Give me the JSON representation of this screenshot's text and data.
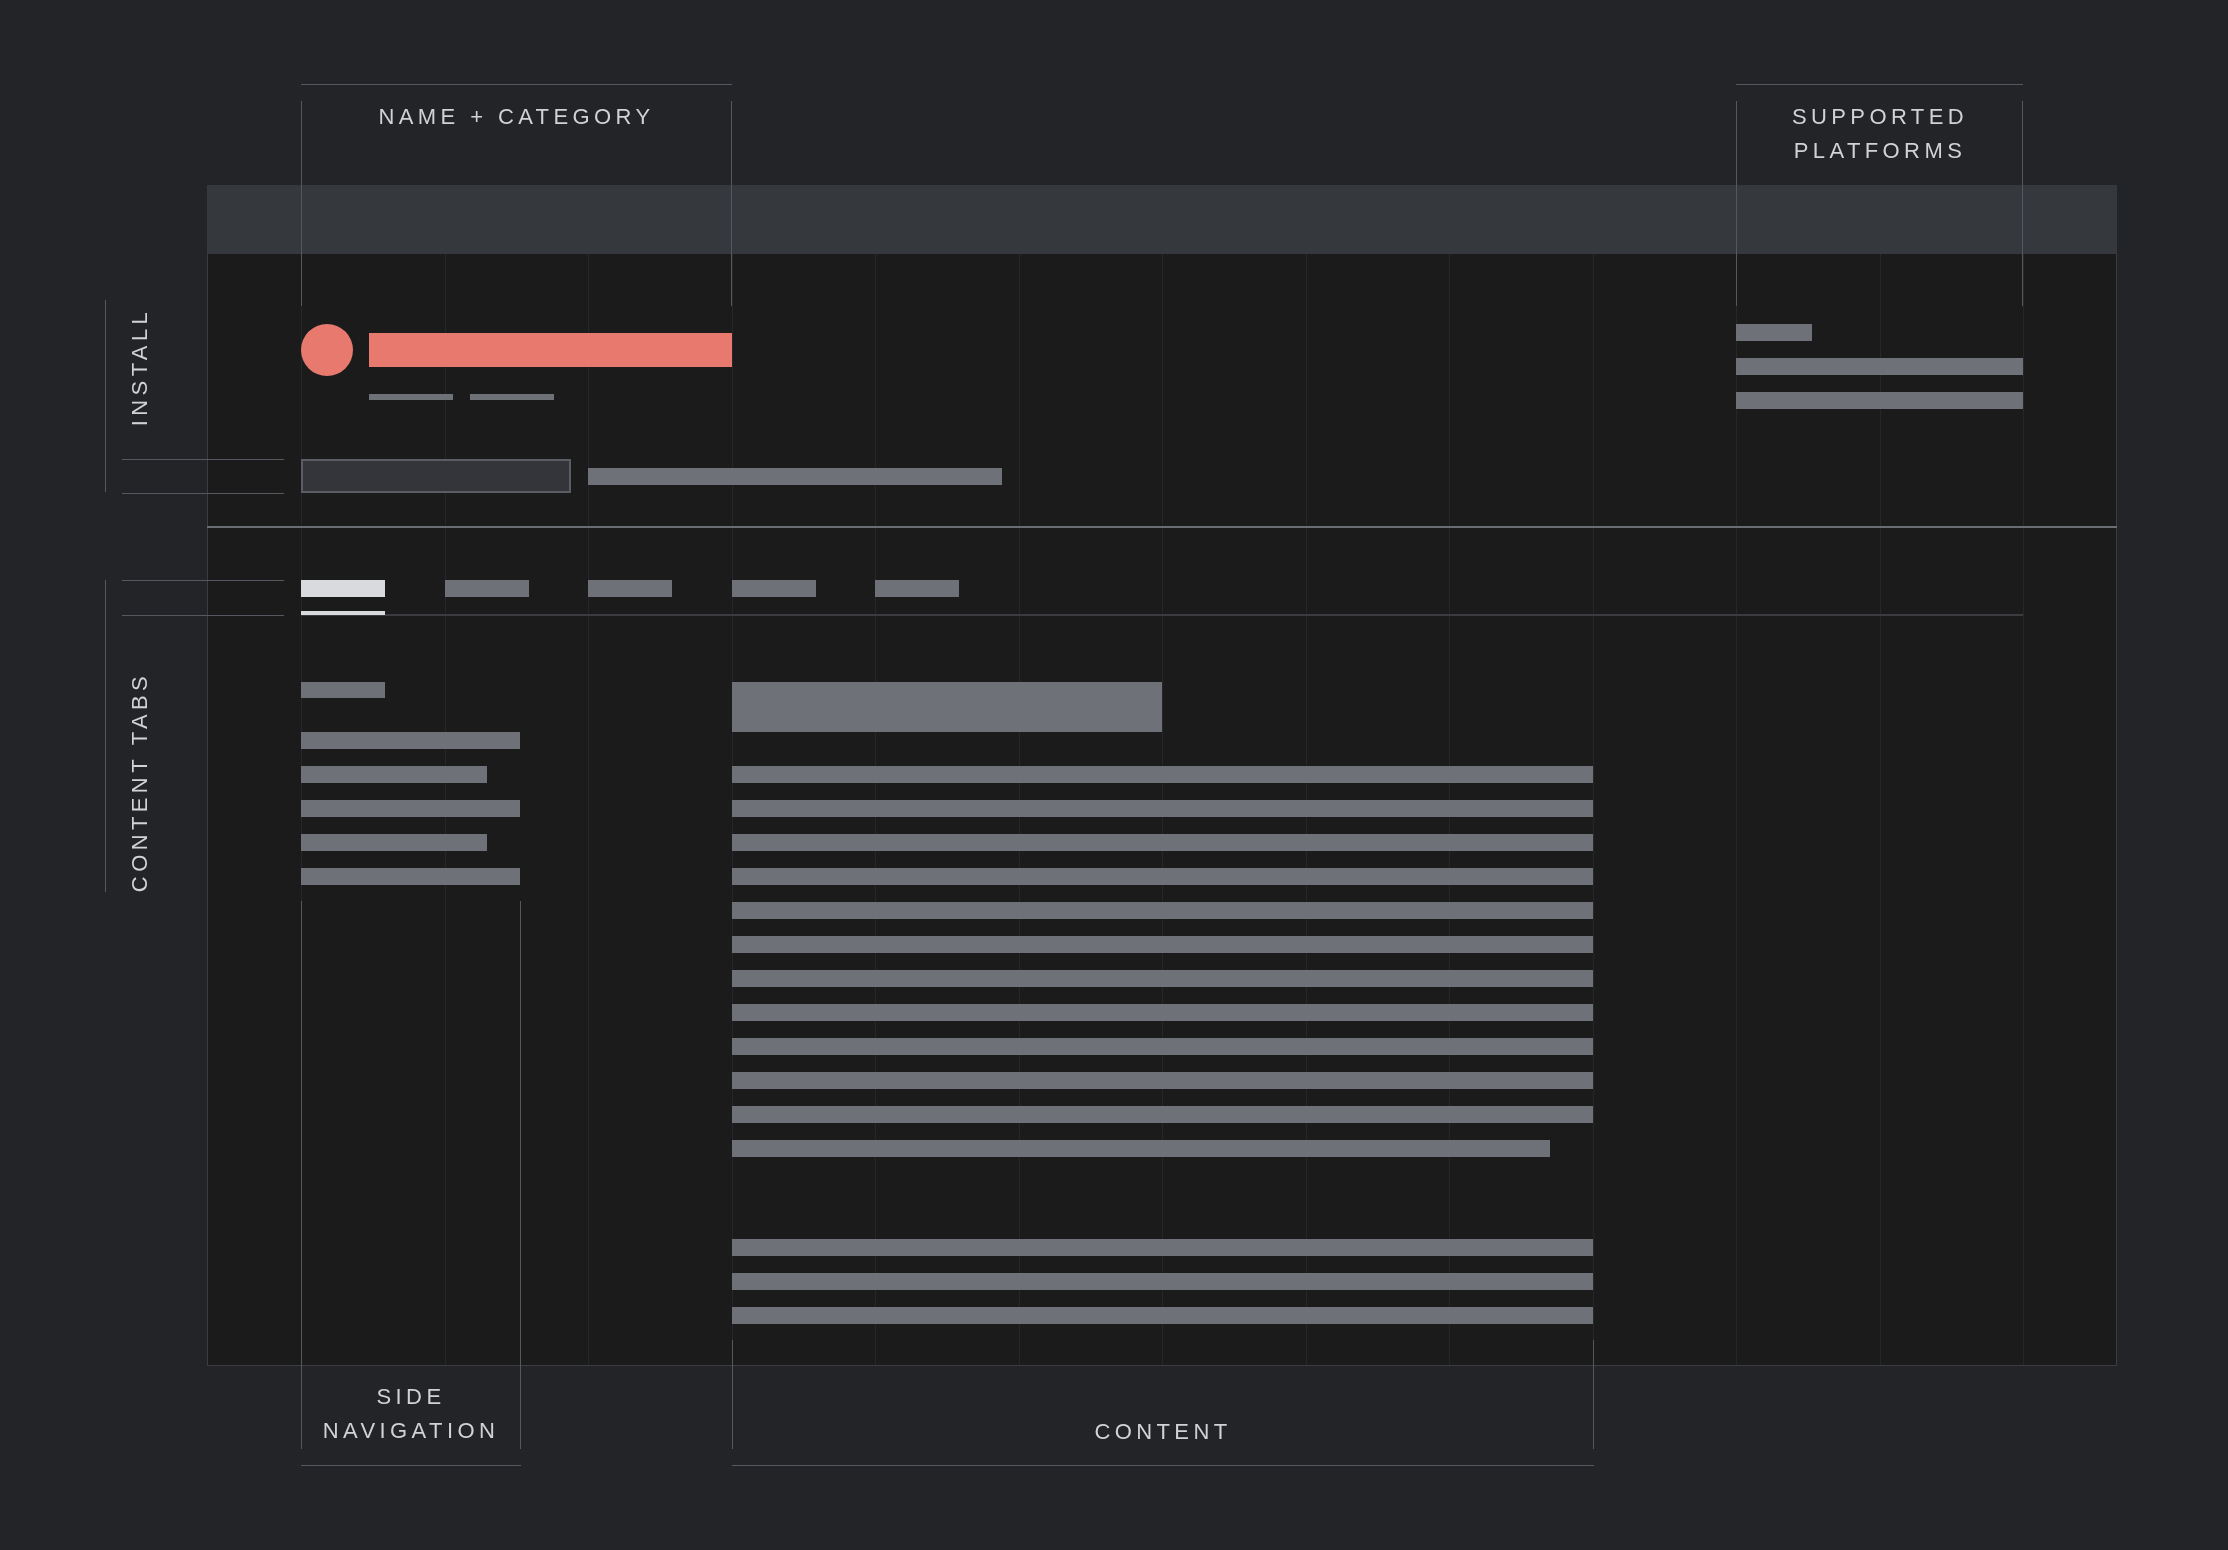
{
  "labels": {
    "name_category": "NAME + CATEGORY",
    "supported_platforms": "SUPPORTED PLATFORMS",
    "install": "INSTALL",
    "content_tabs": "CONTENT TABS",
    "side_navigation": "SIDE NAVIGATION",
    "content": "CONTENT"
  },
  "tabs": [
    {
      "selected": true
    },
    {
      "selected": false
    },
    {
      "selected": false
    },
    {
      "selected": false
    },
    {
      "selected": false
    }
  ]
}
